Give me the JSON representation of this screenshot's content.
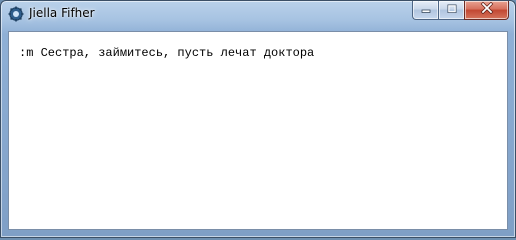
{
  "window": {
    "title": "Jiella Fifher"
  },
  "content": {
    "line": ":m Сестра, займитесь, пусть лечат доктора"
  },
  "colors": {
    "title_bar": "#a7c3e2",
    "close_button": "#c24732",
    "client_background": "#ffffff"
  },
  "icons": {
    "app": "gear-icon",
    "minimize": "minimize-icon",
    "maximize": "maximize-icon",
    "close": "close-icon"
  }
}
